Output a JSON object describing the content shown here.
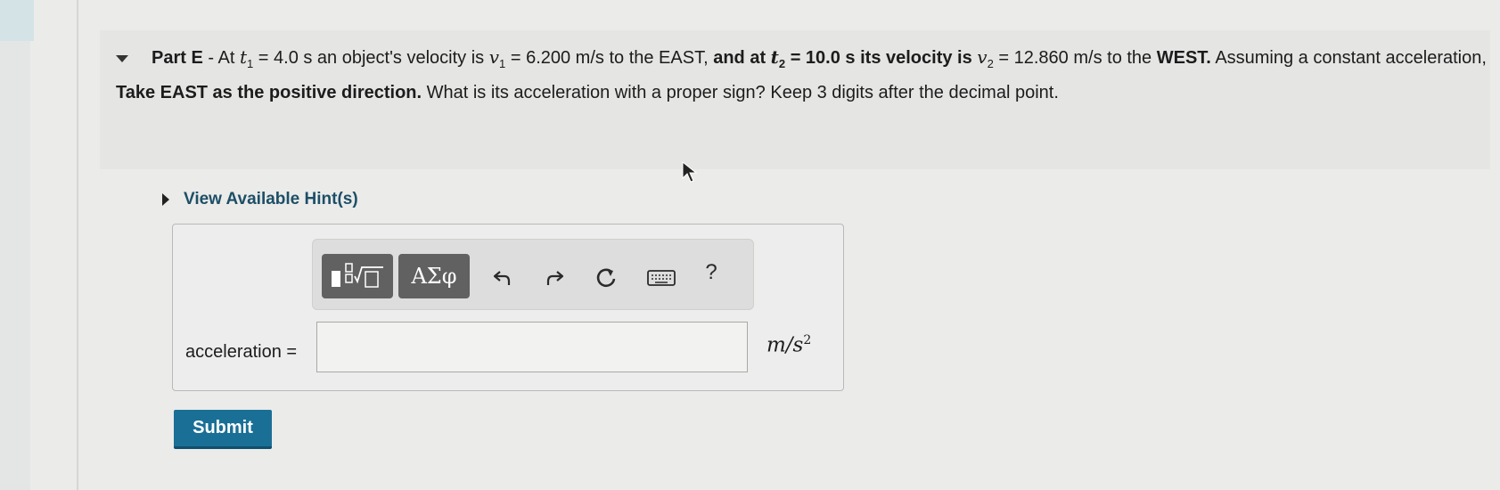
{
  "question": {
    "part_label": "Part E",
    "sep": " - At ",
    "t1_var": "t",
    "t1_sub": "1",
    "t1_value": " = 4.0 s",
    "text_a": " an object's velocity is ",
    "v1_var": "v",
    "v1_sub": "1",
    "v1_value": " = 6.200 m/s",
    "text_b": " to the EAST, ",
    "bold_a": "and at ",
    "t2_var": "t",
    "t2_sub": "2",
    "t2_value": " = 10.0 s",
    "bold_b": " its velocity is ",
    "v2_var": "v",
    "v2_sub": "2",
    "v2_value": " = 12.860 m/s",
    "text_c": " to the ",
    "bold_c": "WEST.",
    "text_d": " Assuming a constant acceleration, ",
    "bold_d": "Take EAST as the positive direction.",
    "text_e": " What is its acceleration with a proper sign?   Keep 3 digits after the decimal point."
  },
  "hints": {
    "label": "View Available Hint(s)"
  },
  "toolbar": {
    "greek_label": "ΑΣφ",
    "help_label": "?"
  },
  "answer": {
    "label": "acceleration =",
    "value": "",
    "unit": "m/s",
    "unit_exp": "2"
  },
  "submit": {
    "label": "Submit"
  },
  "colors": {
    "accent": "#1a6f96",
    "hint_text": "#1d4f66",
    "toolbar_button": "#616161"
  }
}
